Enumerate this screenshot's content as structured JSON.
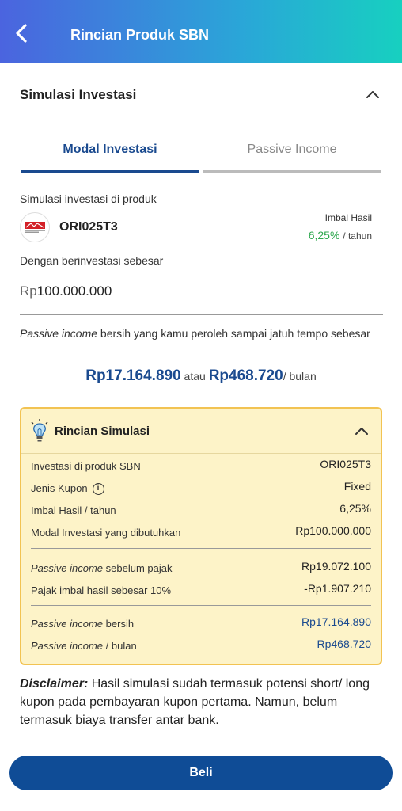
{
  "header": {
    "title": "Rincian Produk SBN"
  },
  "section": {
    "title": "Simulasi Investasi"
  },
  "tabs": [
    {
      "label": "Modal Investasi",
      "active": true
    },
    {
      "label": "Passive Income",
      "active": false
    }
  ],
  "product": {
    "intro": "Simulasi investasi di produk",
    "name": "ORI025T3",
    "imbal_label": "Imbal Hasil",
    "imbal_value": "6,25%",
    "imbal_unit": "/ tahun"
  },
  "investment": {
    "label": "Dengan berinvestasi sebesar",
    "currency": "Rp",
    "amount": "100.000.000"
  },
  "passive": {
    "italic": "Passive income",
    "text": " bersih yang kamu peroleh sampai jatuh tempo sebesar",
    "total": "Rp17.164.890",
    "or": "atau",
    "monthly": "Rp468.720",
    "monthly_unit": "/ bulan"
  },
  "rincian": {
    "title": "Rincian Simulasi",
    "rows": [
      {
        "label": "Investasi di produk SBN",
        "value": "ORI025T3"
      },
      {
        "label": "Jenis Kupon",
        "value": "Fixed"
      },
      {
        "label": "Imbal Hasil / tahun",
        "value": "6,25%"
      },
      {
        "label": "Modal Investasi yang dibutuhkan",
        "value": "Rp100.000.000"
      }
    ],
    "tax_rows": [
      {
        "italic": "Passive income",
        "label": " sebelum pajak",
        "value": "Rp19.072.100"
      },
      {
        "italic": "",
        "label": "Pajak imbal hasil sebesar 10%",
        "value": "-Rp1.907.210"
      }
    ],
    "net_rows": [
      {
        "italic": "Passive income",
        "label": " bersih",
        "value": "Rp17.164.890"
      },
      {
        "italic": "Passive income",
        "label": " / bulan",
        "value": "Rp468.720"
      }
    ]
  },
  "disclaimer": {
    "bold": "Disclaimer:",
    "text": " Hasil simulasi sudah termasuk potensi short/ long kupon pada pembayaran kupon pertama. Namun, belum termasuk biaya transfer antar bank."
  },
  "button": {
    "label": "Beli"
  },
  "colors": {
    "primary": "#1a4a8f",
    "green": "#2fa84f",
    "card_bg": "#fdf3c8",
    "card_border": "#f2c352"
  }
}
